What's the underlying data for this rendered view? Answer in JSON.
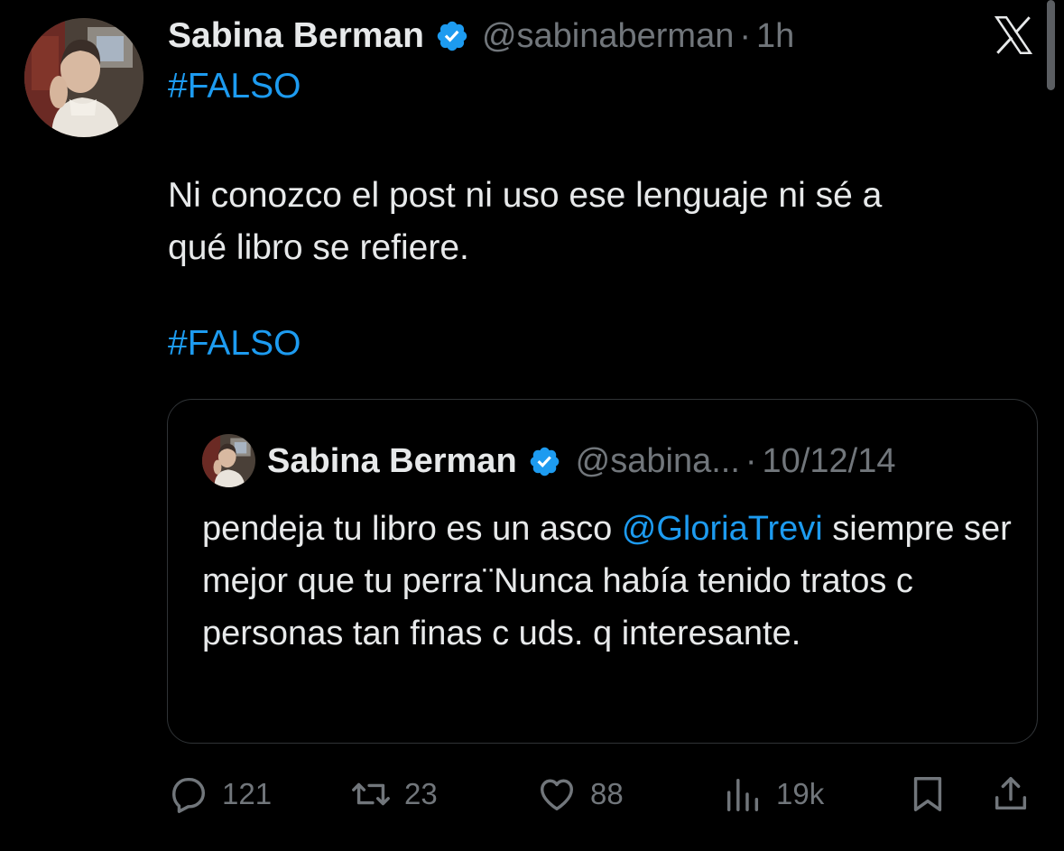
{
  "tweet": {
    "author_name": "Sabina Berman",
    "handle": "@sabinaberman",
    "separator": "·",
    "time": "1h",
    "hashtag_top": "#FALSO",
    "text_line1": "Ni conozco el post ni uso ese lenguaje ni sé a",
    "text_line2": "qué libro se refiere.",
    "hashtag_bottom": "#FALSO"
  },
  "quote": {
    "author_name": "Sabina Berman",
    "handle": "@sabina...",
    "separator": "·",
    "date": "10/12/14",
    "text_before_mention": "pendeja tu libro es un asco ",
    "mention": "@GloriaTrevi",
    "text_after_mention": " siempre ser mejor que tu perra¨Nunca había tenido tratos c personas tan finas c uds. q interesante."
  },
  "actions": {
    "replies": "121",
    "reposts": "23",
    "likes": "88",
    "views": "19k"
  },
  "icons": {
    "verified": "verified-badge-icon",
    "logo": "x-logo-icon",
    "reply": "reply-icon",
    "repost": "repost-icon",
    "like": "heart-icon",
    "views": "views-icon",
    "bookmark": "bookmark-icon",
    "share": "share-icon"
  },
  "colors": {
    "background": "#000000",
    "text": "#e7e9ea",
    "secondary": "#71767b",
    "accent": "#1d9bf0",
    "border": "#2f3336"
  }
}
